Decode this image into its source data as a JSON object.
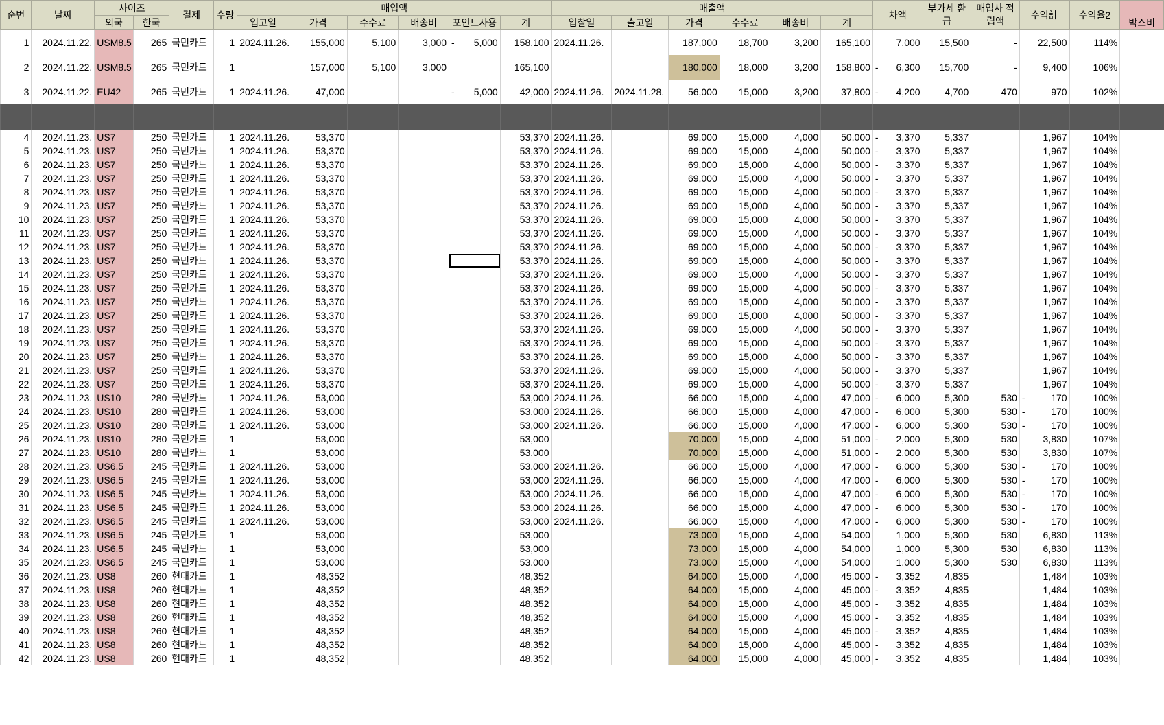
{
  "header": {
    "g1": [
      "순번",
      "날짜",
      "사이즈",
      "결제",
      "수량",
      "매입액",
      "매출액",
      "차액",
      "부가세 환급",
      "매입사 적립액",
      "수익計",
      "수익율2",
      "박스비"
    ],
    "g2_size": [
      "외국",
      "한국"
    ],
    "g2_buy": [
      "입고일",
      "가격",
      "수수료",
      "배송비",
      "포인트사용",
      "계"
    ],
    "g2_sell": [
      "입찰일",
      "출고일",
      "가격",
      "수수료",
      "배송비",
      "계"
    ]
  },
  "rows": [
    {
      "n": "1",
      "d": "2024.11.22.",
      "f": "USM8.5",
      "k": "265",
      "pay": "국민카드",
      "q": "1",
      "in": "2024.11.26.",
      "bp": "155,000",
      "bfee": "5,100",
      "bship": "3,000",
      "pt": "5,000",
      "bsum": "158,100",
      "bid": "2024.11.26.",
      "out": "",
      "sp": "187,000",
      "sfee": "18,700",
      "sship": "3,200",
      "ssum": "165,100",
      "diff": "7,000",
      "vat": "15,500",
      "acc": "-",
      "prof": "22,500",
      "rate": "114%",
      "tall": true
    },
    {
      "n": "2",
      "d": "2024.11.22.",
      "f": "USM8.5",
      "k": "265",
      "pay": "국민카드",
      "q": "1",
      "in": "",
      "bp": "157,000",
      "bfee": "5,100",
      "bship": "3,000",
      "pt": "",
      "bsum": "165,100",
      "bid": "",
      "out": "",
      "sp": "180,000",
      "sfee": "18,000",
      "sship": "3,200",
      "ssum": "158,800",
      "diff": "6,300",
      "diffneg": true,
      "vat": "15,700",
      "acc": "-",
      "prof": "9,400",
      "rate": "106%",
      "olive": true,
      "tall": true
    },
    {
      "n": "3",
      "d": "2024.11.22.",
      "f": "EU42",
      "k": "265",
      "pay": "국민카드",
      "q": "1",
      "in": "2024.11.26.",
      "bp": "47,000",
      "bfee": "",
      "bship": "",
      "pt": "5,000",
      "bsum": "42,000",
      "bid": "2024.11.26.",
      "out": "2024.11.28.",
      "sp": "56,000",
      "sfee": "15,000",
      "sship": "3,200",
      "ssum": "37,800",
      "diff": "4,200",
      "diffneg": true,
      "vat": "4,700",
      "acc": "470",
      "prof": "970",
      "rate": "102%",
      "tall": true
    },
    {
      "n": "4",
      "d": "2024.11.23.",
      "f": "US7",
      "k": "250",
      "pay": "국민카드",
      "q": "1",
      "in": "2024.11.26.",
      "bp": "53,370",
      "bsum": "53,370",
      "bid": "2024.11.26.",
      "sp": "69,000",
      "sfee": "15,000",
      "sship": "4,000",
      "ssum": "50,000",
      "diff": "3,370",
      "diffneg": true,
      "vat": "5,337",
      "acc": "",
      "prof": "1,967",
      "rate": "104%"
    },
    {
      "n": "5",
      "d": "2024.11.23.",
      "f": "US7",
      "k": "250",
      "pay": "국민카드",
      "q": "1",
      "in": "2024.11.26.",
      "bp": "53,370",
      "bsum": "53,370",
      "bid": "2024.11.26.",
      "sp": "69,000",
      "sfee": "15,000",
      "sship": "4,000",
      "ssum": "50,000",
      "diff": "3,370",
      "diffneg": true,
      "vat": "5,337",
      "acc": "",
      "prof": "1,967",
      "rate": "104%"
    },
    {
      "n": "6",
      "d": "2024.11.23.",
      "f": "US7",
      "k": "250",
      "pay": "국민카드",
      "q": "1",
      "in": "2024.11.26.",
      "bp": "53,370",
      "bsum": "53,370",
      "bid": "2024.11.26.",
      "sp": "69,000",
      "sfee": "15,000",
      "sship": "4,000",
      "ssum": "50,000",
      "diff": "3,370",
      "diffneg": true,
      "vat": "5,337",
      "acc": "",
      "prof": "1,967",
      "rate": "104%"
    },
    {
      "n": "7",
      "d": "2024.11.23.",
      "f": "US7",
      "k": "250",
      "pay": "국민카드",
      "q": "1",
      "in": "2024.11.26.",
      "bp": "53,370",
      "bsum": "53,370",
      "bid": "2024.11.26.",
      "sp": "69,000",
      "sfee": "15,000",
      "sship": "4,000",
      "ssum": "50,000",
      "diff": "3,370",
      "diffneg": true,
      "vat": "5,337",
      "acc": "",
      "prof": "1,967",
      "rate": "104%"
    },
    {
      "n": "8",
      "d": "2024.11.23.",
      "f": "US7",
      "k": "250",
      "pay": "국민카드",
      "q": "1",
      "in": "2024.11.26.",
      "bp": "53,370",
      "bsum": "53,370",
      "bid": "2024.11.26.",
      "sp": "69,000",
      "sfee": "15,000",
      "sship": "4,000",
      "ssum": "50,000",
      "diff": "3,370",
      "diffneg": true,
      "vat": "5,337",
      "acc": "",
      "prof": "1,967",
      "rate": "104%"
    },
    {
      "n": "9",
      "d": "2024.11.23.",
      "f": "US7",
      "k": "250",
      "pay": "국민카드",
      "q": "1",
      "in": "2024.11.26.",
      "bp": "53,370",
      "bsum": "53,370",
      "bid": "2024.11.26.",
      "sp": "69,000",
      "sfee": "15,000",
      "sship": "4,000",
      "ssum": "50,000",
      "diff": "3,370",
      "diffneg": true,
      "vat": "5,337",
      "acc": "",
      "prof": "1,967",
      "rate": "104%"
    },
    {
      "n": "10",
      "d": "2024.11.23.",
      "f": "US7",
      "k": "250",
      "pay": "국민카드",
      "q": "1",
      "in": "2024.11.26.",
      "bp": "53,370",
      "bsum": "53,370",
      "bid": "2024.11.26.",
      "sp": "69,000",
      "sfee": "15,000",
      "sship": "4,000",
      "ssum": "50,000",
      "diff": "3,370",
      "diffneg": true,
      "vat": "5,337",
      "acc": "",
      "prof": "1,967",
      "rate": "104%"
    },
    {
      "n": "11",
      "d": "2024.11.23.",
      "f": "US7",
      "k": "250",
      "pay": "국민카드",
      "q": "1",
      "in": "2024.11.26.",
      "bp": "53,370",
      "bsum": "53,370",
      "bid": "2024.11.26.",
      "sp": "69,000",
      "sfee": "15,000",
      "sship": "4,000",
      "ssum": "50,000",
      "diff": "3,370",
      "diffneg": true,
      "vat": "5,337",
      "acc": "",
      "prof": "1,967",
      "rate": "104%"
    },
    {
      "n": "12",
      "d": "2024.11.23.",
      "f": "US7",
      "k": "250",
      "pay": "국민카드",
      "q": "1",
      "in": "2024.11.26.",
      "bp": "53,370",
      "bsum": "53,370",
      "bid": "2024.11.26.",
      "sp": "69,000",
      "sfee": "15,000",
      "sship": "4,000",
      "ssum": "50,000",
      "diff": "3,370",
      "diffneg": true,
      "vat": "5,337",
      "acc": "",
      "prof": "1,967",
      "rate": "104%"
    },
    {
      "n": "13",
      "d": "2024.11.23.",
      "f": "US7",
      "k": "250",
      "pay": "국민카드",
      "q": "1",
      "in": "2024.11.26.",
      "bp": "53,370",
      "bsum": "53,370",
      "bid": "2024.11.26.",
      "sp": "69,000",
      "sfee": "15,000",
      "sship": "4,000",
      "ssum": "50,000",
      "diff": "3,370",
      "diffneg": true,
      "vat": "5,337",
      "acc": "",
      "prof": "1,967",
      "rate": "104%",
      "sel": true
    },
    {
      "n": "14",
      "d": "2024.11.23.",
      "f": "US7",
      "k": "250",
      "pay": "국민카드",
      "q": "1",
      "in": "2024.11.26.",
      "bp": "53,370",
      "bsum": "53,370",
      "bid": "2024.11.26.",
      "sp": "69,000",
      "sfee": "15,000",
      "sship": "4,000",
      "ssum": "50,000",
      "diff": "3,370",
      "diffneg": true,
      "vat": "5,337",
      "acc": "",
      "prof": "1,967",
      "rate": "104%"
    },
    {
      "n": "15",
      "d": "2024.11.23.",
      "f": "US7",
      "k": "250",
      "pay": "국민카드",
      "q": "1",
      "in": "2024.11.26.",
      "bp": "53,370",
      "bsum": "53,370",
      "bid": "2024.11.26.",
      "sp": "69,000",
      "sfee": "15,000",
      "sship": "4,000",
      "ssum": "50,000",
      "diff": "3,370",
      "diffneg": true,
      "vat": "5,337",
      "acc": "",
      "prof": "1,967",
      "rate": "104%"
    },
    {
      "n": "16",
      "d": "2024.11.23.",
      "f": "US7",
      "k": "250",
      "pay": "국민카드",
      "q": "1",
      "in": "2024.11.26.",
      "bp": "53,370",
      "bsum": "53,370",
      "bid": "2024.11.26.",
      "sp": "69,000",
      "sfee": "15,000",
      "sship": "4,000",
      "ssum": "50,000",
      "diff": "3,370",
      "diffneg": true,
      "vat": "5,337",
      "acc": "",
      "prof": "1,967",
      "rate": "104%"
    },
    {
      "n": "17",
      "d": "2024.11.23.",
      "f": "US7",
      "k": "250",
      "pay": "국민카드",
      "q": "1",
      "in": "2024.11.26.",
      "bp": "53,370",
      "bsum": "53,370",
      "bid": "2024.11.26.",
      "sp": "69,000",
      "sfee": "15,000",
      "sship": "4,000",
      "ssum": "50,000",
      "diff": "3,370",
      "diffneg": true,
      "vat": "5,337",
      "acc": "",
      "prof": "1,967",
      "rate": "104%"
    },
    {
      "n": "18",
      "d": "2024.11.23.",
      "f": "US7",
      "k": "250",
      "pay": "국민카드",
      "q": "1",
      "in": "2024.11.26.",
      "bp": "53,370",
      "bsum": "53,370",
      "bid": "2024.11.26.",
      "sp": "69,000",
      "sfee": "15,000",
      "sship": "4,000",
      "ssum": "50,000",
      "diff": "3,370",
      "diffneg": true,
      "vat": "5,337",
      "acc": "",
      "prof": "1,967",
      "rate": "104%"
    },
    {
      "n": "19",
      "d": "2024.11.23.",
      "f": "US7",
      "k": "250",
      "pay": "국민카드",
      "q": "1",
      "in": "2024.11.26.",
      "bp": "53,370",
      "bsum": "53,370",
      "bid": "2024.11.26.",
      "sp": "69,000",
      "sfee": "15,000",
      "sship": "4,000",
      "ssum": "50,000",
      "diff": "3,370",
      "diffneg": true,
      "vat": "5,337",
      "acc": "",
      "prof": "1,967",
      "rate": "104%"
    },
    {
      "n": "20",
      "d": "2024.11.23.",
      "f": "US7",
      "k": "250",
      "pay": "국민카드",
      "q": "1",
      "in": "2024.11.26.",
      "bp": "53,370",
      "bsum": "53,370",
      "bid": "2024.11.26.",
      "sp": "69,000",
      "sfee": "15,000",
      "sship": "4,000",
      "ssum": "50,000",
      "diff": "3,370",
      "diffneg": true,
      "vat": "5,337",
      "acc": "",
      "prof": "1,967",
      "rate": "104%"
    },
    {
      "n": "21",
      "d": "2024.11.23.",
      "f": "US7",
      "k": "250",
      "pay": "국민카드",
      "q": "1",
      "in": "2024.11.26.",
      "bp": "53,370",
      "bsum": "53,370",
      "bid": "2024.11.26.",
      "sp": "69,000",
      "sfee": "15,000",
      "sship": "4,000",
      "ssum": "50,000",
      "diff": "3,370",
      "diffneg": true,
      "vat": "5,337",
      "acc": "",
      "prof": "1,967",
      "rate": "104%"
    },
    {
      "n": "22",
      "d": "2024.11.23.",
      "f": "US7",
      "k": "250",
      "pay": "국민카드",
      "q": "1",
      "in": "2024.11.26.",
      "bp": "53,370",
      "bsum": "53,370",
      "bid": "2024.11.26.",
      "sp": "69,000",
      "sfee": "15,000",
      "sship": "4,000",
      "ssum": "50,000",
      "diff": "3,370",
      "diffneg": true,
      "vat": "5,337",
      "acc": "",
      "prof": "1,967",
      "rate": "104%"
    },
    {
      "n": "23",
      "d": "2024.11.23.",
      "f": "US10",
      "k": "280",
      "pay": "국민카드",
      "q": "1",
      "in": "2024.11.26.",
      "bp": "53,000",
      "bsum": "53,000",
      "bid": "2024.11.26.",
      "sp": "66,000",
      "sfee": "15,000",
      "sship": "4,000",
      "ssum": "47,000",
      "diff": "6,000",
      "diffneg": true,
      "vat": "5,300",
      "acc": "530",
      "prof": "170",
      "profneg": true,
      "rate": "100%"
    },
    {
      "n": "24",
      "d": "2024.11.23.",
      "f": "US10",
      "k": "280",
      "pay": "국민카드",
      "q": "1",
      "in": "2024.11.26.",
      "bp": "53,000",
      "bsum": "53,000",
      "bid": "2024.11.26.",
      "sp": "66,000",
      "sfee": "15,000",
      "sship": "4,000",
      "ssum": "47,000",
      "diff": "6,000",
      "diffneg": true,
      "vat": "5,300",
      "acc": "530",
      "prof": "170",
      "profneg": true,
      "rate": "100%"
    },
    {
      "n": "25",
      "d": "2024.11.23.",
      "f": "US10",
      "k": "280",
      "pay": "국민카드",
      "q": "1",
      "in": "2024.11.26.",
      "bp": "53,000",
      "bsum": "53,000",
      "bid": "2024.11.26.",
      "sp": "66,000",
      "sfee": "15,000",
      "sship": "4,000",
      "ssum": "47,000",
      "diff": "6,000",
      "diffneg": true,
      "vat": "5,300",
      "acc": "530",
      "prof": "170",
      "profneg": true,
      "rate": "100%"
    },
    {
      "n": "26",
      "d": "2024.11.23.",
      "f": "US10",
      "k": "280",
      "pay": "국민카드",
      "q": "1",
      "in": "",
      "bp": "53,000",
      "bsum": "53,000",
      "bid": "",
      "sp": "70,000",
      "olive": true,
      "sfee": "15,000",
      "sship": "4,000",
      "ssum": "51,000",
      "diff": "2,000",
      "diffneg": true,
      "vat": "5,300",
      "acc": "530",
      "prof": "3,830",
      "rate": "107%"
    },
    {
      "n": "27",
      "d": "2024.11.23.",
      "f": "US10",
      "k": "280",
      "pay": "국민카드",
      "q": "1",
      "in": "",
      "bp": "53,000",
      "bsum": "53,000",
      "bid": "",
      "sp": "70,000",
      "olive": true,
      "sfee": "15,000",
      "sship": "4,000",
      "ssum": "51,000",
      "diff": "2,000",
      "diffneg": true,
      "vat": "5,300",
      "acc": "530",
      "prof": "3,830",
      "rate": "107%"
    },
    {
      "n": "28",
      "d": "2024.11.23.",
      "f": "US6.5",
      "k": "245",
      "pay": "국민카드",
      "q": "1",
      "in": "2024.11.26.",
      "bp": "53,000",
      "bsum": "53,000",
      "bid": "2024.11.26.",
      "sp": "66,000",
      "sfee": "15,000",
      "sship": "4,000",
      "ssum": "47,000",
      "diff": "6,000",
      "diffneg": true,
      "vat": "5,300",
      "acc": "530",
      "prof": "170",
      "profneg": true,
      "rate": "100%"
    },
    {
      "n": "29",
      "d": "2024.11.23.",
      "f": "US6.5",
      "k": "245",
      "pay": "국민카드",
      "q": "1",
      "in": "2024.11.26.",
      "bp": "53,000",
      "bsum": "53,000",
      "bid": "2024.11.26.",
      "sp": "66,000",
      "sfee": "15,000",
      "sship": "4,000",
      "ssum": "47,000",
      "diff": "6,000",
      "diffneg": true,
      "vat": "5,300",
      "acc": "530",
      "prof": "170",
      "profneg": true,
      "rate": "100%"
    },
    {
      "n": "30",
      "d": "2024.11.23.",
      "f": "US6.5",
      "k": "245",
      "pay": "국민카드",
      "q": "1",
      "in": "2024.11.26.",
      "bp": "53,000",
      "bsum": "53,000",
      "bid": "2024.11.26.",
      "sp": "66,000",
      "sfee": "15,000",
      "sship": "4,000",
      "ssum": "47,000",
      "diff": "6,000",
      "diffneg": true,
      "vat": "5,300",
      "acc": "530",
      "prof": "170",
      "profneg": true,
      "rate": "100%"
    },
    {
      "n": "31",
      "d": "2024.11.23.",
      "f": "US6.5",
      "k": "245",
      "pay": "국민카드",
      "q": "1",
      "in": "2024.11.26.",
      "bp": "53,000",
      "bsum": "53,000",
      "bid": "2024.11.26.",
      "sp": "66,000",
      "sfee": "15,000",
      "sship": "4,000",
      "ssum": "47,000",
      "diff": "6,000",
      "diffneg": true,
      "vat": "5,300",
      "acc": "530",
      "prof": "170",
      "profneg": true,
      "rate": "100%"
    },
    {
      "n": "32",
      "d": "2024.11.23.",
      "f": "US6.5",
      "k": "245",
      "pay": "국민카드",
      "q": "1",
      "in": "2024.11.26.",
      "bp": "53,000",
      "bsum": "53,000",
      "bid": "2024.11.26.",
      "sp": "66,000",
      "sfee": "15,000",
      "sship": "4,000",
      "ssum": "47,000",
      "diff": "6,000",
      "diffneg": true,
      "vat": "5,300",
      "acc": "530",
      "prof": "170",
      "profneg": true,
      "rate": "100%"
    },
    {
      "n": "33",
      "d": "2024.11.23.",
      "f": "US6.5",
      "k": "245",
      "pay": "국민카드",
      "q": "1",
      "in": "",
      "bp": "53,000",
      "bsum": "53,000",
      "bid": "",
      "sp": "73,000",
      "olive": true,
      "sfee": "15,000",
      "sship": "4,000",
      "ssum": "54,000",
      "diff": "1,000",
      "vat": "5,300",
      "acc": "530",
      "prof": "6,830",
      "rate": "113%"
    },
    {
      "n": "34",
      "d": "2024.11.23.",
      "f": "US6.5",
      "k": "245",
      "pay": "국민카드",
      "q": "1",
      "in": "",
      "bp": "53,000",
      "bsum": "53,000",
      "bid": "",
      "sp": "73,000",
      "olive": true,
      "sfee": "15,000",
      "sship": "4,000",
      "ssum": "54,000",
      "diff": "1,000",
      "vat": "5,300",
      "acc": "530",
      "prof": "6,830",
      "rate": "113%"
    },
    {
      "n": "35",
      "d": "2024.11.23.",
      "f": "US6.5",
      "k": "245",
      "pay": "국민카드",
      "q": "1",
      "in": "",
      "bp": "53,000",
      "bsum": "53,000",
      "bid": "",
      "sp": "73,000",
      "olive": true,
      "sfee": "15,000",
      "sship": "4,000",
      "ssum": "54,000",
      "diff": "1,000",
      "vat": "5,300",
      "acc": "530",
      "prof": "6,830",
      "rate": "113%"
    },
    {
      "n": "36",
      "d": "2024.11.23.",
      "f": "US8",
      "k": "260",
      "pay": "현대카드",
      "q": "1",
      "in": "",
      "bp": "48,352",
      "bsum": "48,352",
      "bid": "",
      "sp": "64,000",
      "olive": true,
      "sfee": "15,000",
      "sship": "4,000",
      "ssum": "45,000",
      "diff": "3,352",
      "diffneg": true,
      "vat": "4,835",
      "acc": "",
      "prof": "1,484",
      "rate": "103%"
    },
    {
      "n": "37",
      "d": "2024.11.23.",
      "f": "US8",
      "k": "260",
      "pay": "현대카드",
      "q": "1",
      "in": "",
      "bp": "48,352",
      "bsum": "48,352",
      "bid": "",
      "sp": "64,000",
      "olive": true,
      "sfee": "15,000",
      "sship": "4,000",
      "ssum": "45,000",
      "diff": "3,352",
      "diffneg": true,
      "vat": "4,835",
      "acc": "",
      "prof": "1,484",
      "rate": "103%"
    },
    {
      "n": "38",
      "d": "2024.11.23.",
      "f": "US8",
      "k": "260",
      "pay": "현대카드",
      "q": "1",
      "in": "",
      "bp": "48,352",
      "bsum": "48,352",
      "bid": "",
      "sp": "64,000",
      "olive": true,
      "sfee": "15,000",
      "sship": "4,000",
      "ssum": "45,000",
      "diff": "3,352",
      "diffneg": true,
      "vat": "4,835",
      "acc": "",
      "prof": "1,484",
      "rate": "103%"
    },
    {
      "n": "39",
      "d": "2024.11.23.",
      "f": "US8",
      "k": "260",
      "pay": "현대카드",
      "q": "1",
      "in": "",
      "bp": "48,352",
      "bsum": "48,352",
      "bid": "",
      "sp": "64,000",
      "olive": true,
      "sfee": "15,000",
      "sship": "4,000",
      "ssum": "45,000",
      "diff": "3,352",
      "diffneg": true,
      "vat": "4,835",
      "acc": "",
      "prof": "1,484",
      "rate": "103%"
    },
    {
      "n": "40",
      "d": "2024.11.23.",
      "f": "US8",
      "k": "260",
      "pay": "현대카드",
      "q": "1",
      "in": "",
      "bp": "48,352",
      "bsum": "48,352",
      "bid": "",
      "sp": "64,000",
      "olive": true,
      "sfee": "15,000",
      "sship": "4,000",
      "ssum": "45,000",
      "diff": "3,352",
      "diffneg": true,
      "vat": "4,835",
      "acc": "",
      "prof": "1,484",
      "rate": "103%"
    },
    {
      "n": "41",
      "d": "2024.11.23.",
      "f": "US8",
      "k": "260",
      "pay": "현대카드",
      "q": "1",
      "in": "",
      "bp": "48,352",
      "bsum": "48,352",
      "bid": "",
      "sp": "64,000",
      "olive": true,
      "sfee": "15,000",
      "sship": "4,000",
      "ssum": "45,000",
      "diff": "3,352",
      "diffneg": true,
      "vat": "4,835",
      "acc": "",
      "prof": "1,484",
      "rate": "103%"
    },
    {
      "n": "42",
      "d": "2024.11.23.",
      "f": "US8",
      "k": "260",
      "pay": "현대카드",
      "q": "1",
      "in": "",
      "bp": "48,352",
      "bsum": "48,352",
      "bid": "",
      "sp": "64,000",
      "olive": true,
      "sfee": "15,000",
      "sship": "4,000",
      "ssum": "45,000",
      "diff": "3,352",
      "diffneg": true,
      "vat": "4,835",
      "acc": "",
      "prof": "1,484",
      "rate": "103%"
    }
  ]
}
